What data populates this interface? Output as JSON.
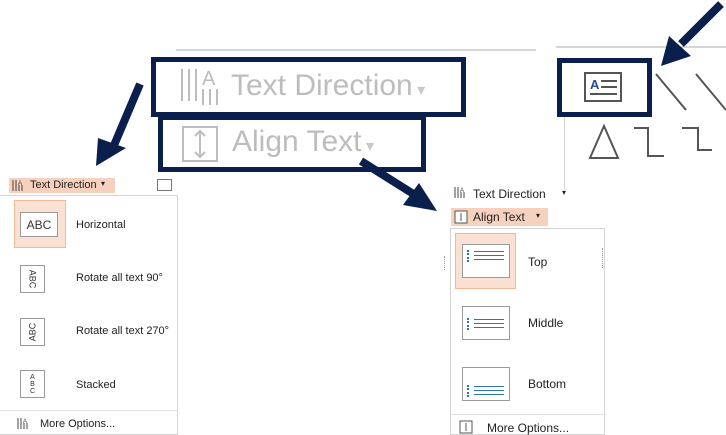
{
  "ribbon": {
    "text_direction_label": "Text Direction",
    "align_text_label": "Align Text"
  },
  "left_menu": {
    "header": "Text Direction",
    "items": [
      {
        "thumb": "ABC",
        "label": "Horizontal"
      },
      {
        "thumb": "ABC",
        "label": "Rotate all text 90°"
      },
      {
        "thumb": "ABC",
        "label": "Rotate all text 270°"
      },
      {
        "thumb": "A B C",
        "label": "Stacked"
      }
    ],
    "more": "More Options..."
  },
  "right_menu": {
    "header_direction": "Text Direction",
    "header_align": "Align Text",
    "items": [
      {
        "label": "Top"
      },
      {
        "label": "Middle"
      },
      {
        "label": "Bottom"
      }
    ],
    "more": "More Options..."
  },
  "colors": {
    "callout": "#0b1f4d",
    "selected": "#fbe1d3",
    "accent_lines": "#2e75b6"
  }
}
